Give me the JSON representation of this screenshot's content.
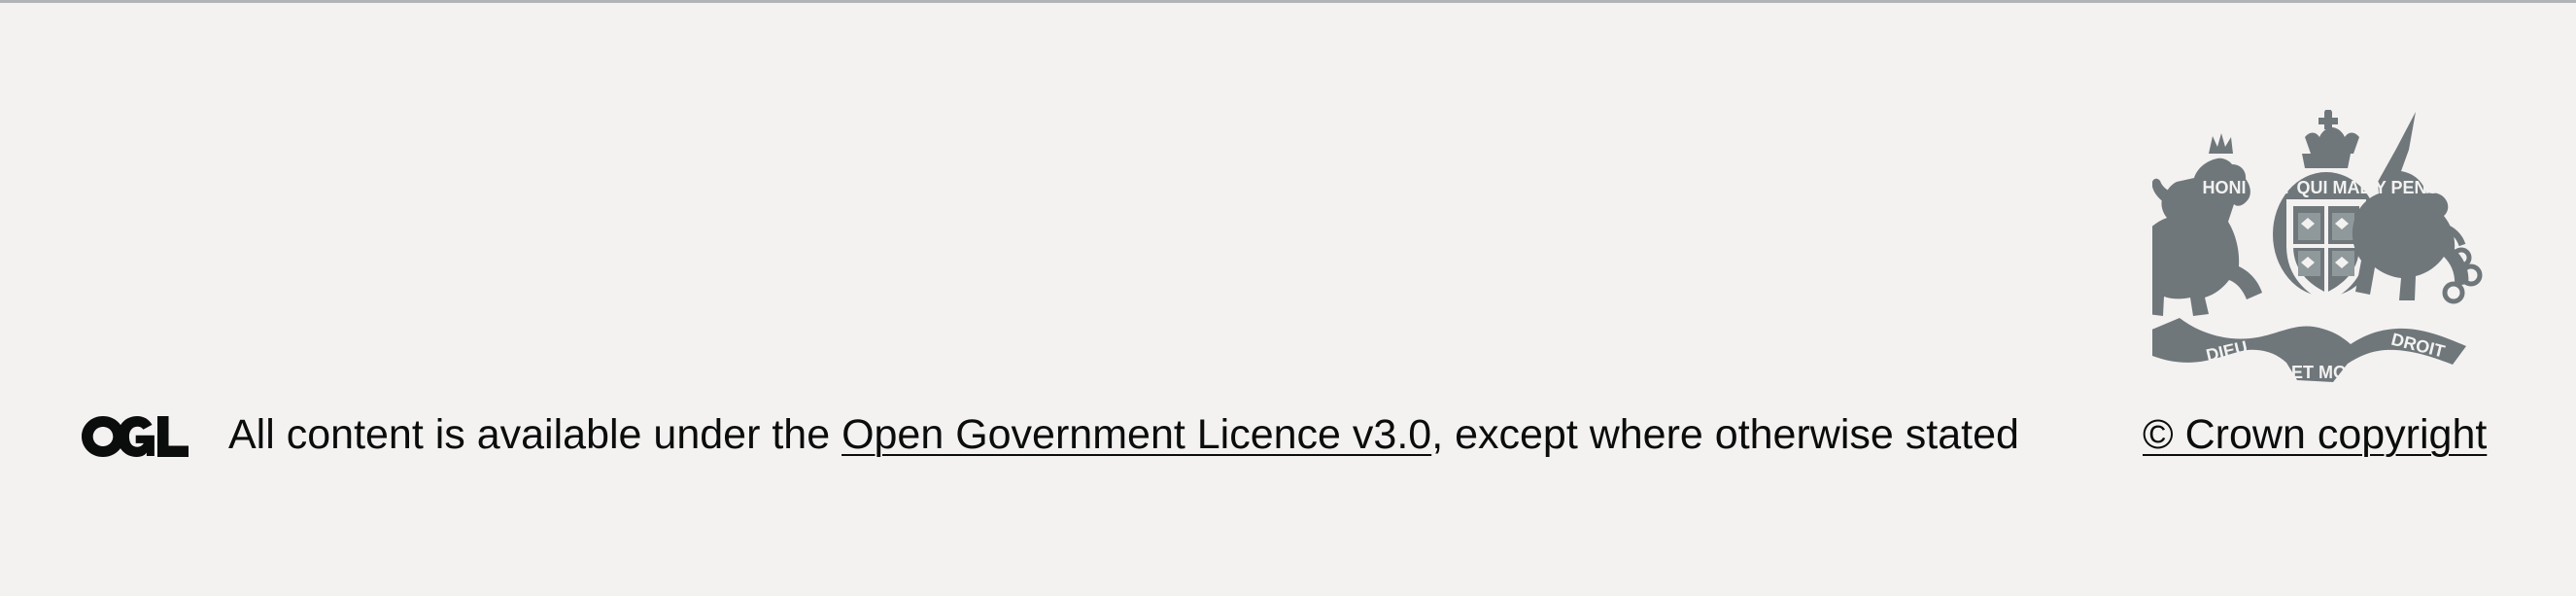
{
  "footer": {
    "ogl_logo": {
      "icon": "ogl-logo-icon",
      "text": "OGL"
    },
    "licence": {
      "prefix": "All content is available under the ",
      "link_text": "Open Government Licence v3.0",
      "suffix": ", except where otherwise stated"
    },
    "crest": {
      "icon": "royal-coat-of-arms-icon",
      "motto_top": "HONI SOIT QUI MAL Y PENSE",
      "motto_bottom_left": "DIEU",
      "motto_bottom_center": "ET MON",
      "motto_bottom_right": "DROIT"
    },
    "copyright": {
      "link_text": "© Crown copyright"
    }
  },
  "colors": {
    "background": "#f3f2f1",
    "border": "#b1b4b6",
    "text": "#0b0c0c",
    "crest": "#6f777b"
  }
}
